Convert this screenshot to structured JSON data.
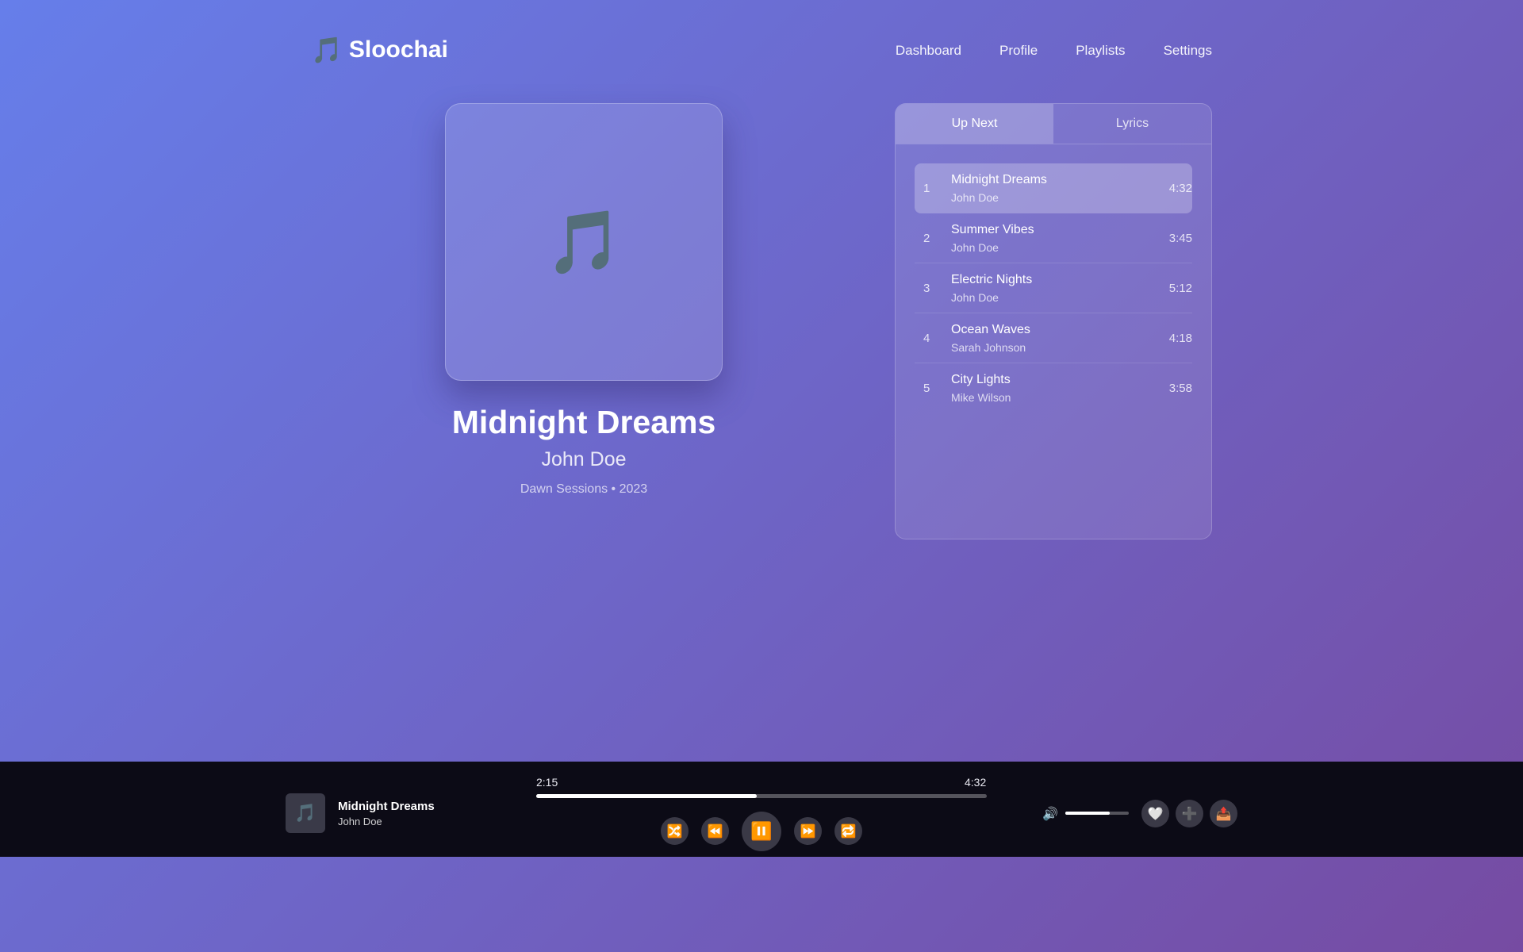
{
  "app": {
    "name": "Sloochai",
    "logo_icon": "🎵"
  },
  "nav": {
    "items": [
      "Dashboard",
      "Profile",
      "Playlists",
      "Settings"
    ]
  },
  "now_playing": {
    "title": "Midnight Dreams",
    "artist": "John Doe",
    "meta": "Dawn Sessions • 2023",
    "art_icon": "🎵"
  },
  "panel": {
    "tabs": [
      "Up Next",
      "Lyrics"
    ],
    "active_tab": "Up Next",
    "queue": [
      {
        "num": "1",
        "title": "Midnight Dreams",
        "artist": "John Doe",
        "duration": "4:32",
        "active": true
      },
      {
        "num": "2",
        "title": "Summer Vibes",
        "artist": "John Doe",
        "duration": "3:45",
        "active": false
      },
      {
        "num": "3",
        "title": "Electric Nights",
        "artist": "John Doe",
        "duration": "5:12",
        "active": false
      },
      {
        "num": "4",
        "title": "Ocean Waves",
        "artist": "Sarah Johnson",
        "duration": "4:18",
        "active": false
      },
      {
        "num": "5",
        "title": "City Lights",
        "artist": "Mike Wilson",
        "duration": "3:58",
        "active": false
      }
    ]
  },
  "player": {
    "title": "Midnight Dreams",
    "artist": "John Doe",
    "mini_art_icon": "🎵",
    "current_time": "2:15",
    "total_time": "4:32",
    "progress": 0.49,
    "volume": 0.7,
    "controls": {
      "shuffle": "🔀",
      "prev": "⏪",
      "play_pause": "⏸️",
      "next": "⏩",
      "repeat": "🔁"
    },
    "actions": {
      "like": "🤍",
      "add": "➕",
      "share": "📤"
    },
    "volume_icon": "🔊"
  },
  "colors": {
    "bg_start": "#667eea",
    "bg_end": "#764ba2",
    "player_bg": "#0c0b16"
  }
}
